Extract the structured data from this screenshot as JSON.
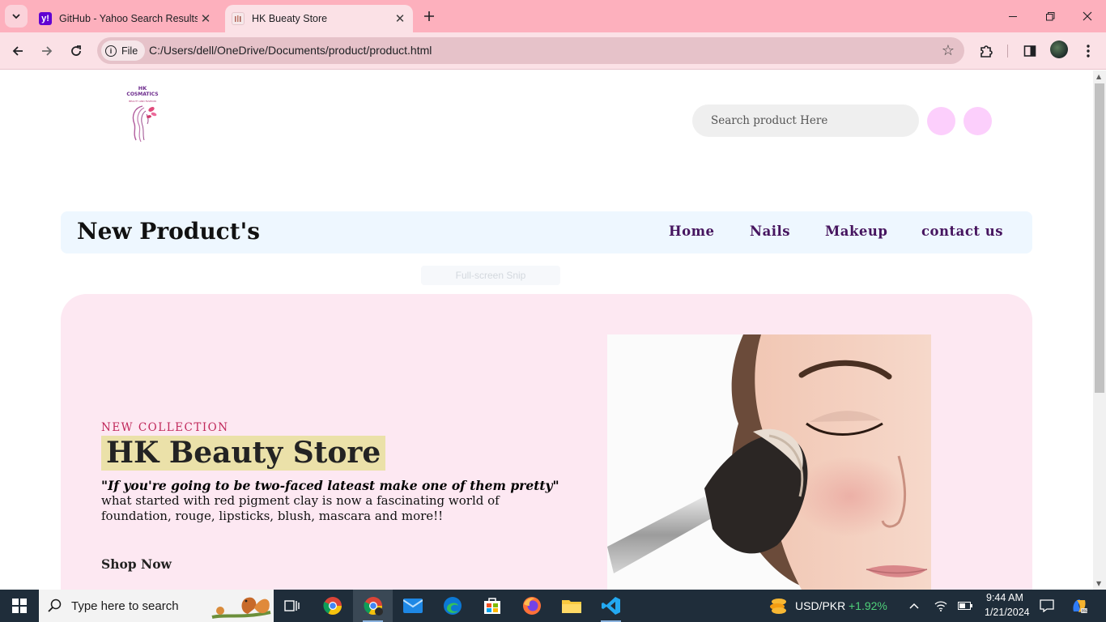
{
  "browser": {
    "tabs": [
      {
        "title": "GitHub - Yahoo Search Results",
        "favicon": "yahoo-icon",
        "active": false
      },
      {
        "title": "HK Bueaty Store",
        "favicon": "hk-store-icon",
        "active": true
      }
    ],
    "site_chip": "File",
    "url": "C:/Users/dell/OneDrive/Documents/product/product.html"
  },
  "header": {
    "logo": {
      "line1": "HK",
      "line2": "COSMATICS",
      "line3": "BEAUTY AND FASHION"
    },
    "search_placeholder": "Search product Here"
  },
  "nav": {
    "brand": "New Product's",
    "links": [
      "Home",
      "Nails",
      "Makeup",
      "contact us"
    ]
  },
  "ghost_overlay": "Full-screen Snip",
  "hero": {
    "eyebrow": "NEW COLLECTION",
    "title": "HK Beauty Store",
    "quote": "\"If you're going to be two-faced lateast make one of them pretty\"",
    "description": "what started with red pigment clay is now a fascinating world of foundation, rouge, lipsticks, blush, mascara and more!!",
    "cta": "Shop Now"
  },
  "taskbar": {
    "search_placeholder": "Type here to search",
    "currency_pair": "USD/PKR",
    "currency_change": "+1.92%",
    "time": "9:44 AM",
    "date": "1/21/2024"
  },
  "colors": {
    "tab_strip": "#fdb0bd",
    "toolbar": "#fbe1e6",
    "nav_bg": "#eef7ff",
    "nav_link": "#46155f",
    "hero_bg": "#fde8f2",
    "title_highlight": "#ebe1a9",
    "eyebrow": "#c0275a",
    "circle_buttons": "#fccffc",
    "taskbar": "#1f2d3a",
    "positive_change": "#4fd17a"
  }
}
